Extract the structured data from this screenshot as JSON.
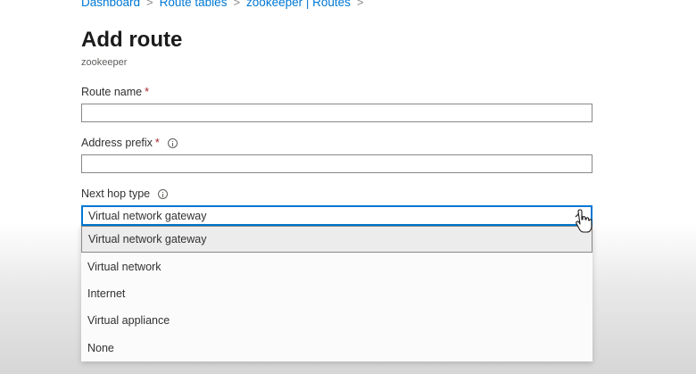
{
  "breadcrumb": [
    {
      "label": "Dashboard"
    },
    {
      "label": "Route tables"
    },
    {
      "label": "zookeeper | Routes"
    }
  ],
  "page": {
    "title": "Add route",
    "subtitle": "zookeeper"
  },
  "fields": {
    "route_name": {
      "label": "Route name",
      "required_mark": "*",
      "value": ""
    },
    "address_prefix": {
      "label": "Address prefix",
      "required_mark": "*",
      "value": ""
    },
    "next_hop_type": {
      "label": "Next hop type",
      "selected": "Virtual network gateway",
      "options": [
        {
          "label": "Virtual network gateway"
        },
        {
          "label": "Virtual network"
        },
        {
          "label": "Internet"
        },
        {
          "label": "Virtual appliance"
        },
        {
          "label": "None"
        }
      ]
    }
  },
  "colors": {
    "link": "#0078d4",
    "focus_border": "#0078d4",
    "required": "#a4262c"
  },
  "icons": [
    "chevron-right-icon",
    "info-icon",
    "chevron-up-icon",
    "hand-cursor-icon"
  ]
}
